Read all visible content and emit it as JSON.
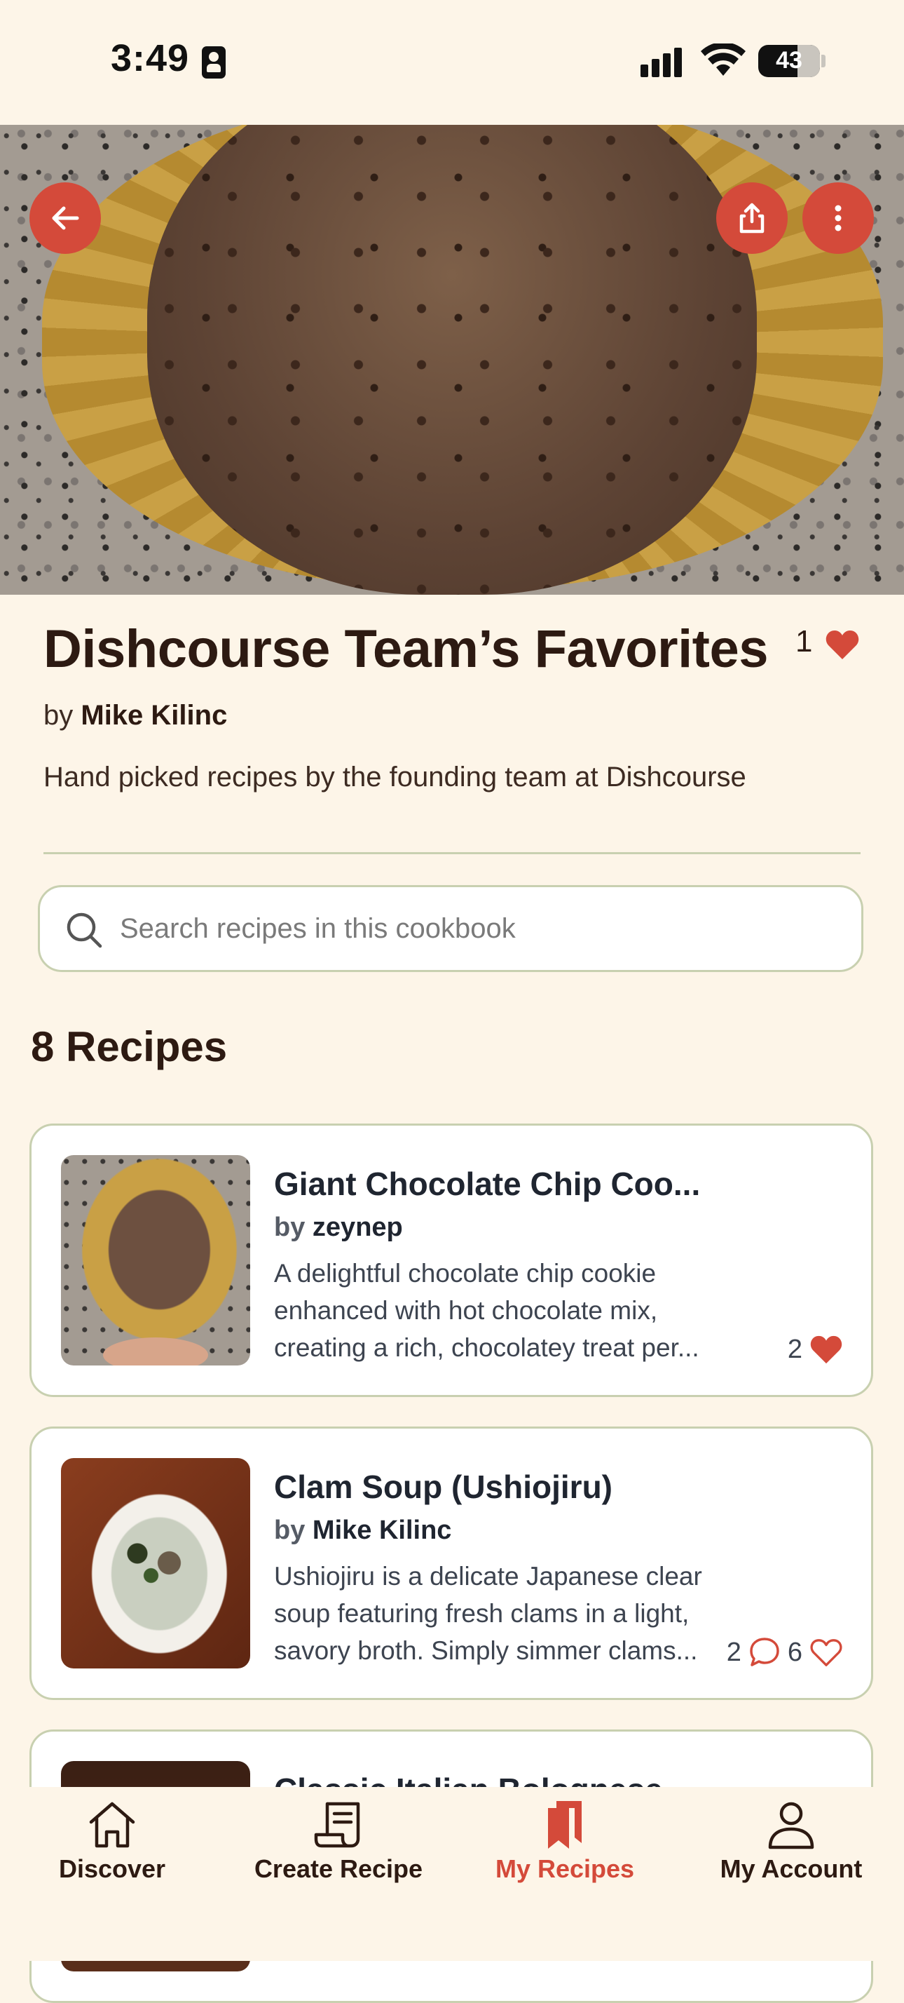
{
  "status_bar": {
    "time": "3:49",
    "battery": "43"
  },
  "header": {
    "title": "Dishcourse Team’s Favorites",
    "like_count": "1",
    "by_prefix": "by",
    "author": "Mike Kilinc",
    "description": "Hand picked recipes by the founding team at Dishcourse"
  },
  "search": {
    "placeholder": "Search recipes in this cookbook"
  },
  "recipes_count_label": "8 Recipes",
  "recipes": [
    {
      "title": "Giant Chocolate Chip Coo...",
      "by": "by",
      "author": "zeynep",
      "description": "A delightful chocolate chip cookie enhanced with hot chocolate mix, creating a rich, chocolatey treat per...",
      "likes": "2"
    },
    {
      "title": "Clam Soup (Ushiojiru)",
      "by": "by",
      "author": "Mike Kilinc",
      "description": "Ushiojiru is a delicate Japanese clear soup featuring fresh clams in a light, savory broth. Simply simmer clams...",
      "comments": "2",
      "likes": "6"
    },
    {
      "title": "Classic Italian Bolognese"
    }
  ],
  "nav": {
    "discover": "Discover",
    "create": "Create Recipe",
    "my_recipes": "My Recipes",
    "account": "My Account"
  },
  "colors": {
    "accent": "#d44a3a",
    "background": "#fdf5e8",
    "border": "#c8d0b0",
    "text": "#2d1a12"
  }
}
